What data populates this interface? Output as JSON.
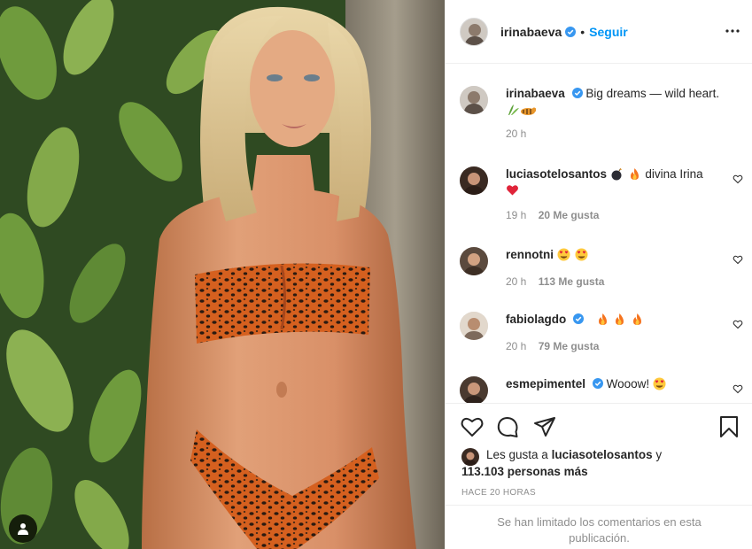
{
  "post": {
    "username": "irinabaeva",
    "separator": "•",
    "follow_label": "Seguir",
    "verified_icon": "verified-badge-icon",
    "more_icon": "more-options-icon"
  },
  "caption": {
    "username": "irinabaeva",
    "text": "Big dreams — wild heart.",
    "emoji_note": "plant-and-tiger-emoji",
    "time": "20 h"
  },
  "comments": [
    {
      "username": "luciasotelosantos",
      "verified": false,
      "prefix_emojis": "bomb, fire",
      "text": "divina Irina",
      "suffix_emoji": "red-heart",
      "time": "19 h",
      "likes": "20 Me gusta"
    },
    {
      "username": "rennotni",
      "verified": false,
      "prefix_emojis": "",
      "text": "",
      "suffix_emoji": "heart-eyes x2",
      "time": "20 h",
      "likes": "113 Me gusta"
    },
    {
      "username": "fabiolagdo",
      "verified": true,
      "prefix_emojis": "",
      "text": "",
      "suffix_emoji": "fire x3",
      "time": "20 h",
      "likes": "79 Me gusta"
    },
    {
      "username": "esmepimentel",
      "verified": true,
      "prefix_emojis": "",
      "text": "Wooow!",
      "suffix_emoji": "heart-eyes",
      "time": "",
      "likes": ""
    }
  ],
  "actions": {
    "like_icon": "heart-icon",
    "comment_icon": "comment-icon",
    "share_icon": "paper-plane-icon",
    "save_icon": "bookmark-icon"
  },
  "likes": {
    "prefix": "Les gusta a",
    "user": "luciasotelosantos",
    "middle": "y",
    "count": "113.103 personas más"
  },
  "time_ago": "HACE 20 HORAS",
  "comments_limited": "Se han limitado los comentarios en esta publicación.",
  "colors": {
    "accent": "#0095f6",
    "text": "#262626",
    "muted": "#8e8e8e",
    "divider": "#efefef",
    "heart_red": "#ed4956"
  }
}
